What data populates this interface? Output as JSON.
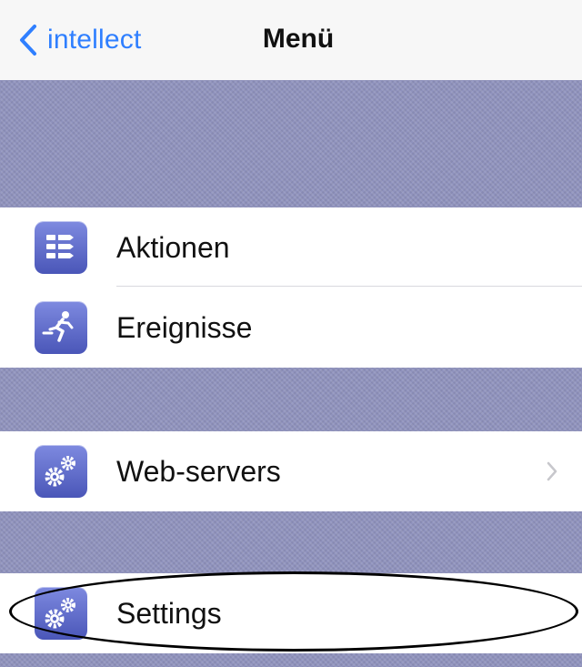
{
  "nav": {
    "back_label": "intellect",
    "title": "Menü"
  },
  "menu": {
    "items": [
      {
        "label": "Aktionen",
        "icon": "actions-list-icon"
      },
      {
        "label": "Ereignisse",
        "icon": "running-person-icon"
      },
      {
        "label": "Web-servers",
        "icon": "gears-icon",
        "has_disclosure": true
      },
      {
        "label": "Settings",
        "icon": "gears-icon",
        "highlighted": true
      }
    ]
  },
  "colors": {
    "nav_background": "#f7f7f7",
    "back_link": "#2f7fff",
    "section_background": "#8f92bd",
    "icon_gradient_top": "#7e8ae0",
    "icon_gradient_bottom": "#4a56b8"
  }
}
